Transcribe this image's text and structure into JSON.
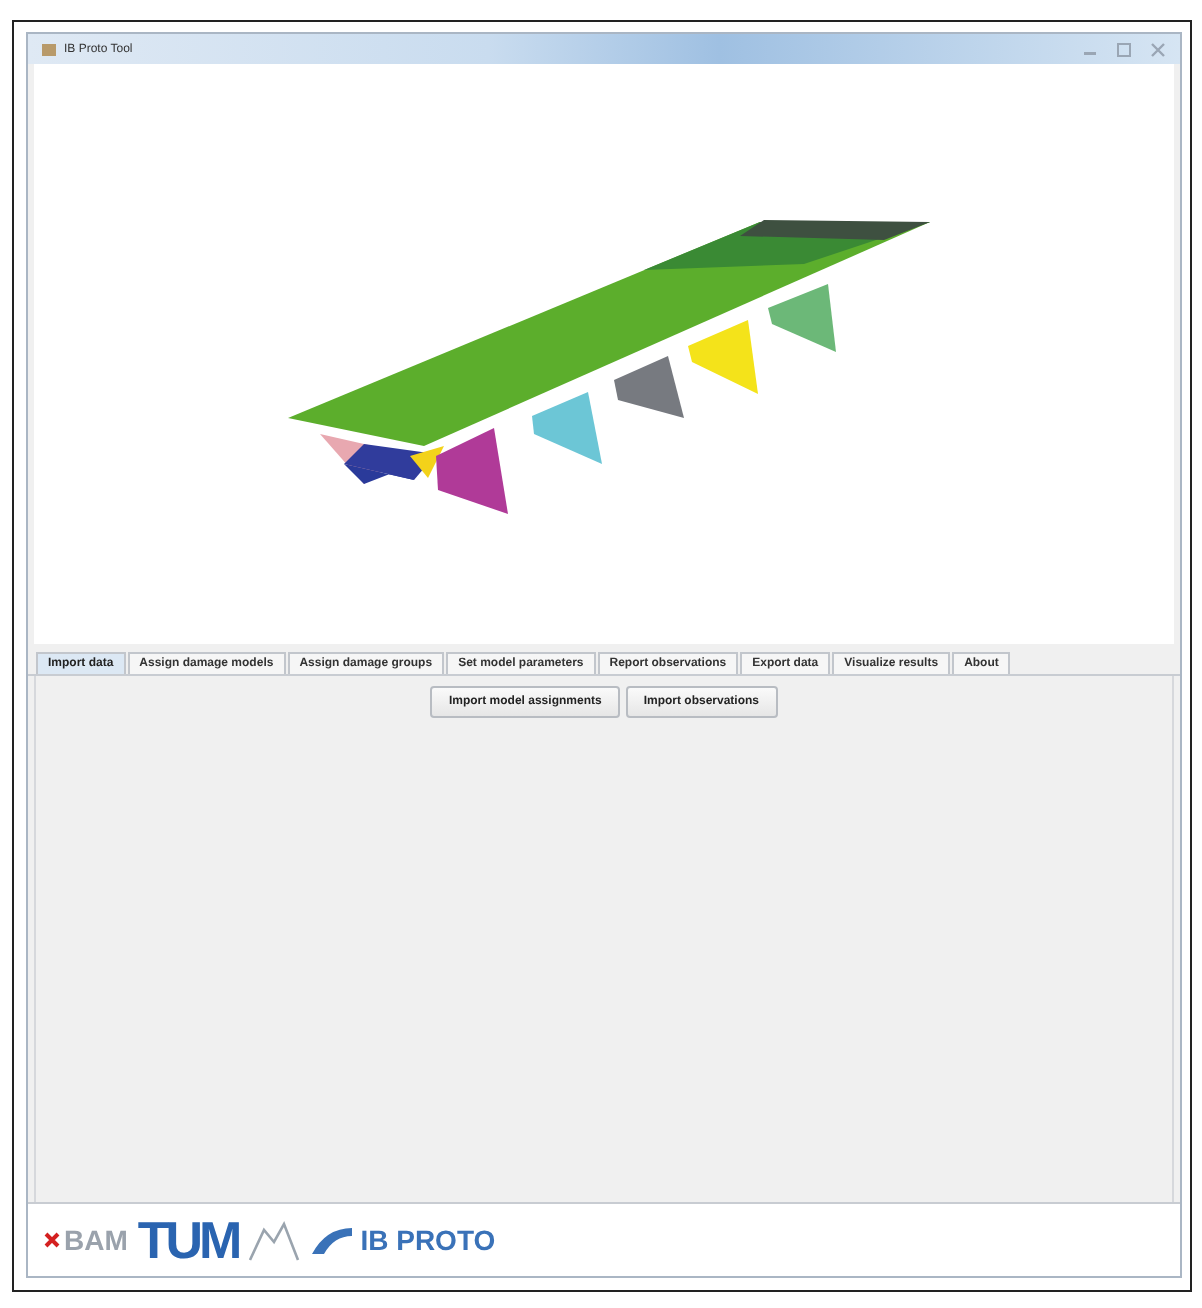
{
  "window": {
    "title": "IB Proto Tool"
  },
  "tabs": [
    {
      "label": "Import data",
      "selected": true
    },
    {
      "label": "Assign damage models",
      "selected": false
    },
    {
      "label": "Assign damage groups",
      "selected": false
    },
    {
      "label": "Set model parameters",
      "selected": false
    },
    {
      "label": "Report observations",
      "selected": false
    },
    {
      "label": "Export data",
      "selected": false
    },
    {
      "label": "Visualize results",
      "selected": false
    },
    {
      "label": "About",
      "selected": false
    }
  ],
  "buttons": [
    "Import model assignments",
    "Import observations"
  ],
  "logos": [
    {
      "kind": "bam",
      "text": "BAM"
    },
    {
      "kind": "tum",
      "text": "TUM"
    },
    {
      "kind": "house"
    },
    {
      "kind": "ibproto",
      "text": "IB PROTO"
    }
  ]
}
